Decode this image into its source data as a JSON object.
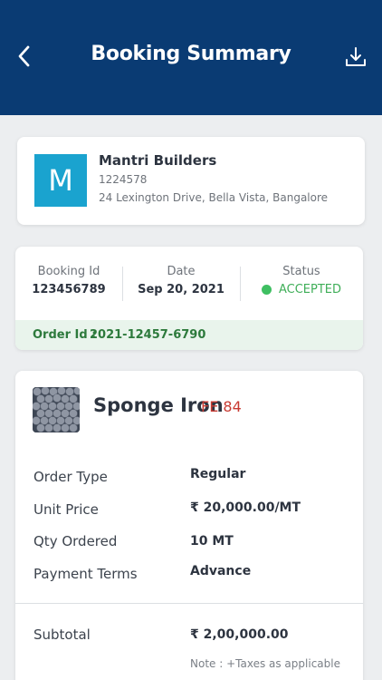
{
  "header": {
    "title": "Booking Summary",
    "back_icon": "chevron-left-icon",
    "download_icon": "download-icon",
    "bg_color": "#0a3b73"
  },
  "company": {
    "avatar_letter": "M",
    "name": "Mantri Builders",
    "code": "1224578",
    "address": "24 Lexington Drive, Bella Vista, Bangalore",
    "avatar_color": "#1aa3cf"
  },
  "booking": {
    "id_label": "Booking Id",
    "id_value": "123456789",
    "date_label": "Date",
    "date_value": "Sep 20, 2021",
    "status_label": "Status",
    "status_value": "ACCEPTED",
    "status_color": "#3fbf62",
    "order_id_label": "Order Id :",
    "order_id_value": "2021-12457-6790"
  },
  "product": {
    "name": "Sponge Iron",
    "grade": "FE 84",
    "rows": [
      {
        "label": "Order Type",
        "value": "Regular"
      },
      {
        "label": "Unit Price",
        "value": "₹ 20,000.00/MT"
      },
      {
        "label": "Qty Ordered",
        "value": "10 MT"
      },
      {
        "label": "Payment Terms",
        "value": "Advance"
      }
    ],
    "subtotal_label": "Subtotal",
    "subtotal_value": "₹ 2,00,000.00",
    "note": "Note : +Taxes as applicable"
  }
}
